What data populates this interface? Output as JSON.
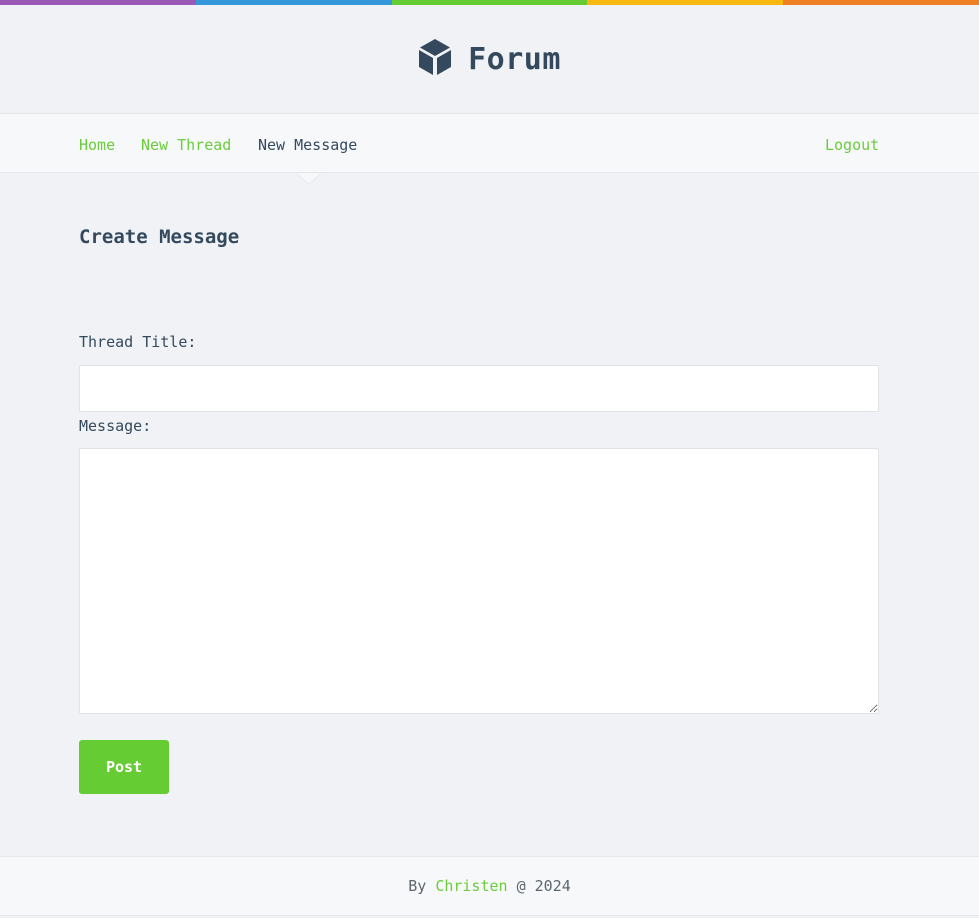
{
  "colors": {
    "top_bar": [
      "#9b59b6",
      "#3498db",
      "#66cc33",
      "#f9b811",
      "#ee7f22"
    ],
    "accent": "#65cc33",
    "text": "#34495e"
  },
  "header": {
    "logo_icon": "cube-icon",
    "title": "Forum"
  },
  "nav": {
    "home": "Home",
    "new_thread": "New Thread",
    "new_message": "New Message",
    "logout": "Logout",
    "active": "New Message"
  },
  "main": {
    "heading": "Create Message",
    "thread_title_label": "Thread Title:",
    "thread_title_value": "",
    "message_label": "Message:",
    "message_value": "",
    "post_button": "Post"
  },
  "footer": {
    "prefix": "By ",
    "author": "Christen",
    "suffix": " @ 2024"
  }
}
